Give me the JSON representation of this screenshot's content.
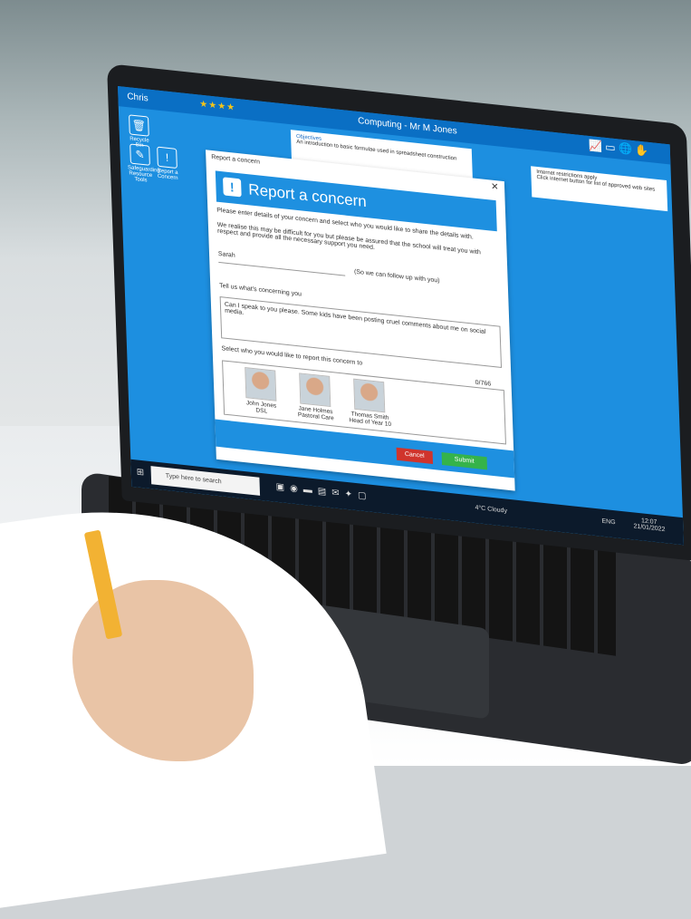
{
  "topbar": {
    "user": "Chris",
    "rating": "★★★★",
    "class_title": "Computing - Mr M Jones"
  },
  "desktop": {
    "icons": [
      {
        "label": "Recycle Bin",
        "glyph": "🗑"
      },
      {
        "label": "Safeguarding Resource Tools",
        "glyph": "✎"
      },
      {
        "label": "Report a Concern",
        "glyph": "!"
      }
    ]
  },
  "objectives": {
    "title": "Objectives",
    "text": "An introduction to basic formulae used in spreadsheet construction"
  },
  "restrictions": {
    "line1": "Internet restrictions apply",
    "line2": "Click internet button for list of approved web sites"
  },
  "dialog": {
    "window_title": "Report a concern",
    "heading": "Report a concern",
    "intro": "Please enter details of your concern and select who you would like to share the details with.",
    "reassurance": "We realise this may be difficult for you but please be assured that the school will treat you with respect and provide all the necessary support you need.",
    "name_value": "Sarah",
    "name_hint": "(So we can follow up with you)",
    "concern_label": "Tell us what's concerning you",
    "concern_value": "Can I speak to you please. Some kids have been posting cruel comments about me on social media.",
    "select_label": "Select who you would like to report this concern to",
    "char_count": "0/766",
    "staff": [
      {
        "name": "John Jones",
        "role": "DSL"
      },
      {
        "name": "Jane Holmes",
        "role": "Pastoral Care"
      },
      {
        "name": "Thomas Smith",
        "role": "Head of Year 10"
      }
    ],
    "cancel_label": "Cancel",
    "submit_label": "Submit"
  },
  "taskbar": {
    "search_placeholder": "Type here to search",
    "weather": "4°C Cloudy",
    "lang": "ENG",
    "time": "12:07",
    "date": "21/01/2022"
  }
}
